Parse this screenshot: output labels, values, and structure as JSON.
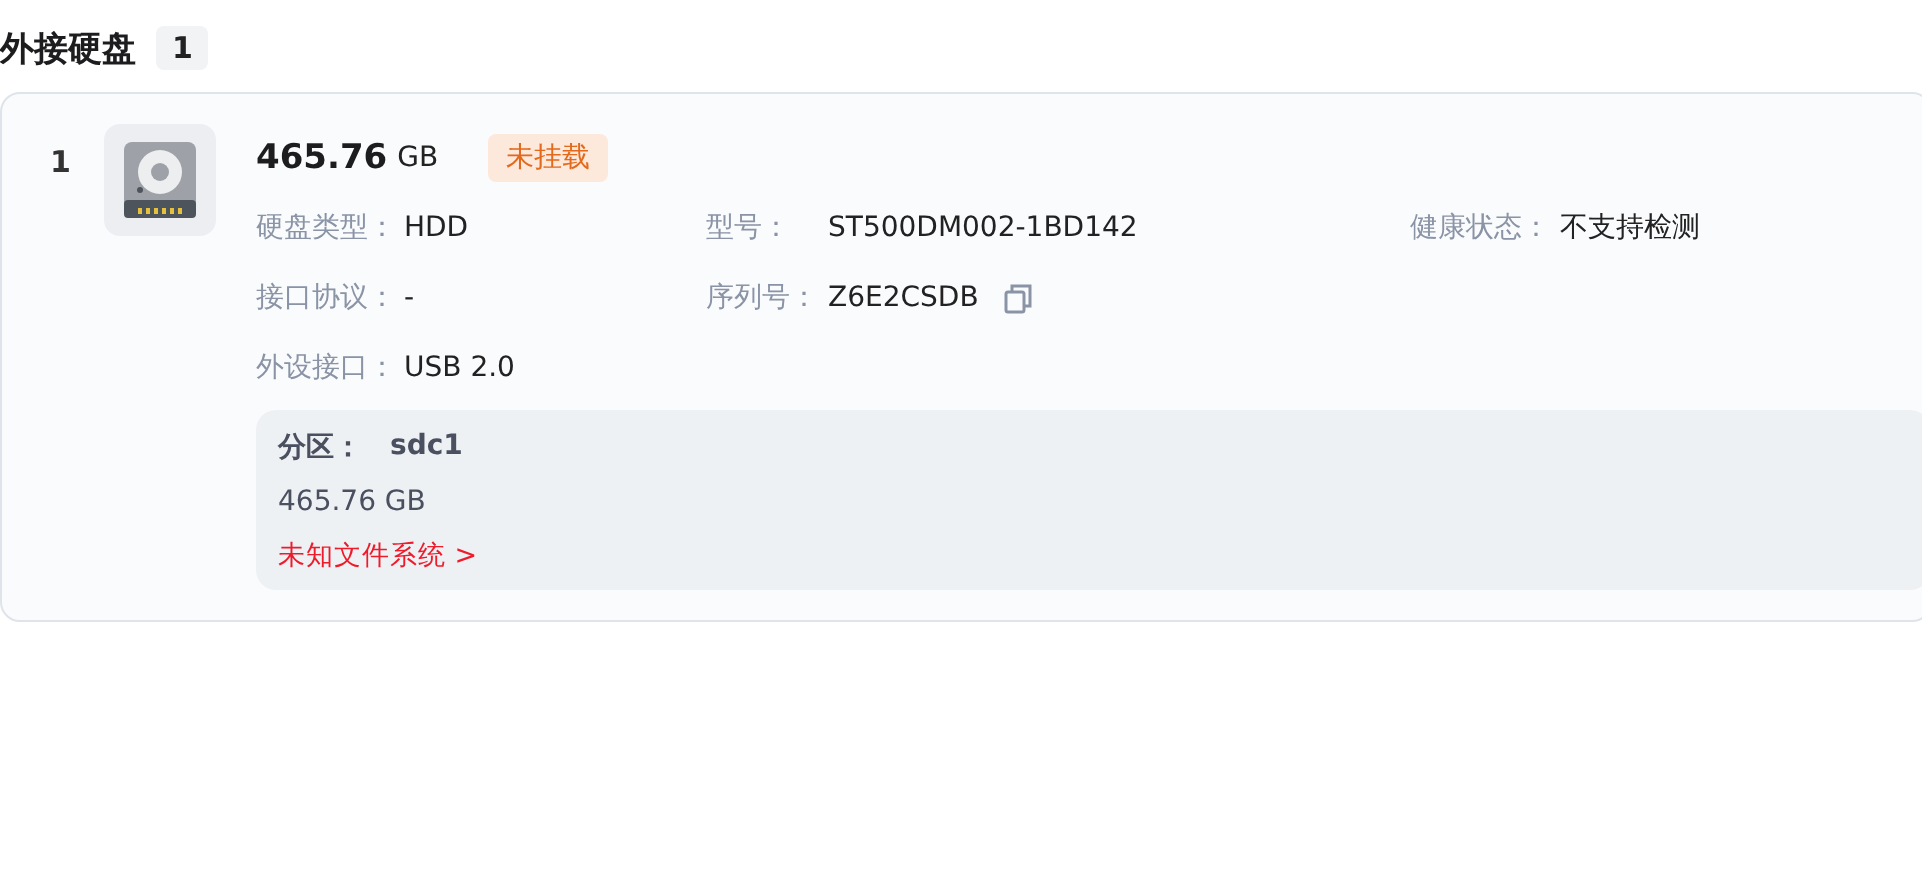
{
  "section": {
    "title": "外接硬盘",
    "count": "1"
  },
  "disks": [
    {
      "index": "1",
      "size": "465.76",
      "unit": "GB",
      "status": {
        "label": "未挂载",
        "mounted": false
      },
      "rows": [
        [
          {
            "label": "硬盘类型：",
            "value": "HDD"
          },
          {
            "label": "型号：",
            "value": "ST500DM002-1BD142"
          },
          {
            "label": "健康状态：",
            "value": "不支持检测"
          }
        ],
        [
          {
            "label": "接口协议：",
            "value": "-"
          },
          {
            "label": "序列号：",
            "value": "Z6E2CSDB",
            "copyable": true
          }
        ],
        [
          {
            "label": "外设接口：",
            "value": "USB 2.0"
          }
        ]
      ],
      "partitions": [
        {
          "label": "分区：",
          "name": "sdc1",
          "size": "465.76 GB",
          "filesystem": "未知文件系统 >"
        }
      ]
    }
  ]
}
